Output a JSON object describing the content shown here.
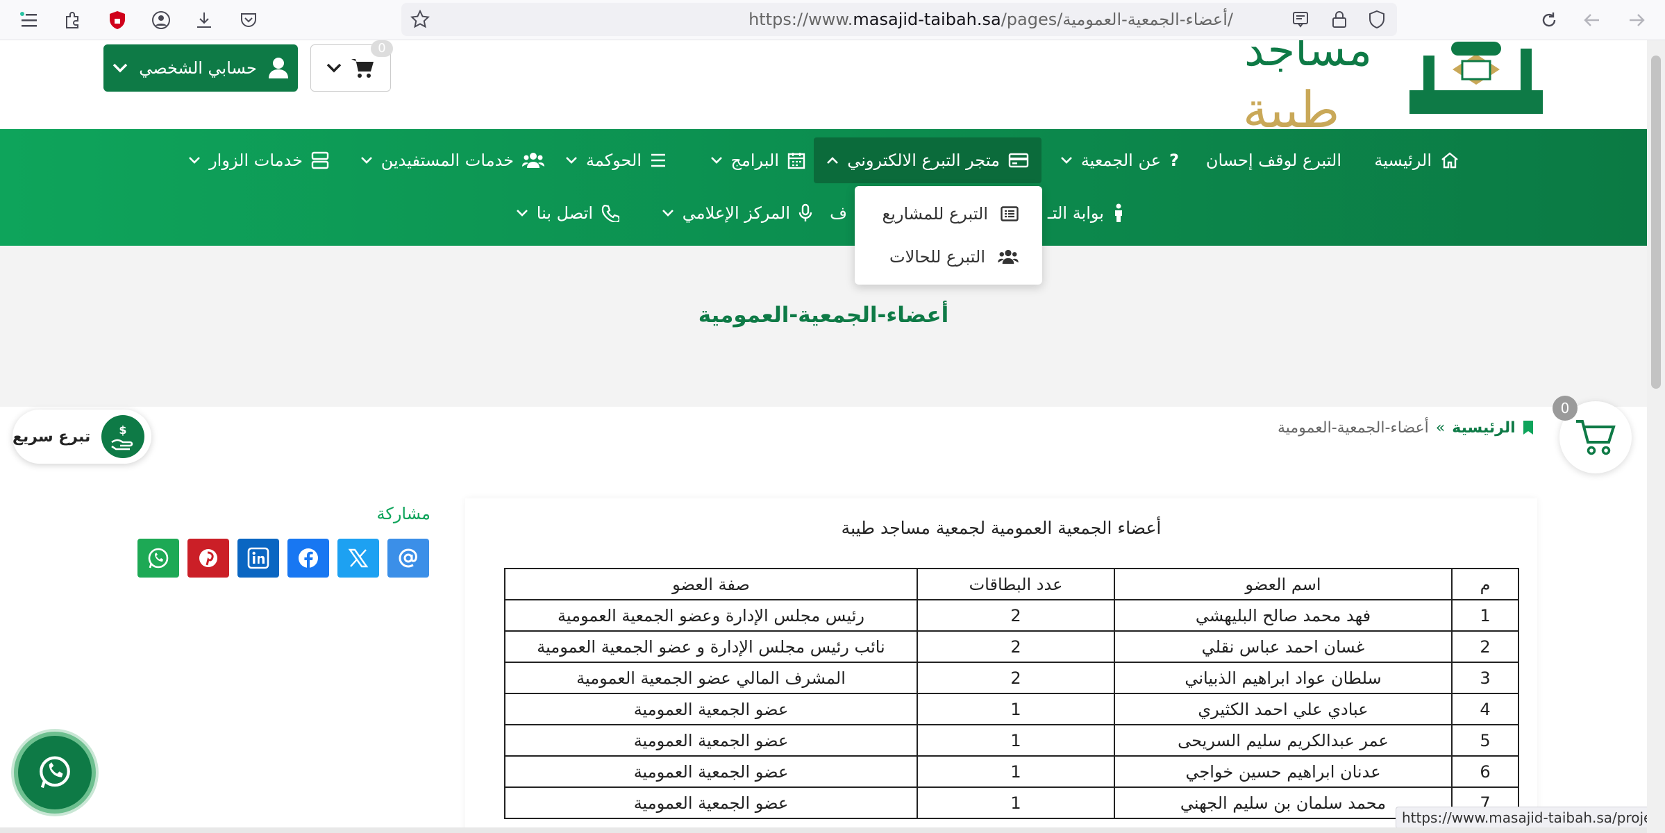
{
  "browser": {
    "url_prefix": "https://www.",
    "url_domain": "masajid-taibah.sa",
    "url_path": "/pages/أعضاء-الجمعية-العمومية/"
  },
  "header": {
    "logo_text_top": "مساجد",
    "logo_text": "طيبة",
    "account_label": "حسابي الشخصي",
    "cart_count": "0"
  },
  "nav": {
    "items": [
      {
        "label": "الرئيسية",
        "icon": "home-icon"
      },
      {
        "label": "التبرع لوقف إحسان",
        "icon": ""
      },
      {
        "label": "عن الجمعية",
        "icon": "question-icon"
      },
      {
        "label": "متجر التبرع الالكتروني",
        "icon": "card-icon"
      },
      {
        "label": "البرامج",
        "icon": "calendar-icon"
      },
      {
        "label": "الحوكمة",
        "icon": "list-icon"
      },
      {
        "label": "خدمات المستفيدين",
        "icon": "users-icon"
      },
      {
        "label": "خدمات الزوار",
        "icon": "server-icon"
      }
    ],
    "row2": [
      {
        "label": "بوابة التـ",
        "icon": "person-icon"
      },
      {
        "label": "ف",
        "icon": ""
      },
      {
        "label": "المركز الإعلامي",
        "icon": "mic-icon"
      },
      {
        "label": "اتصل بنا",
        "icon": "phone-icon"
      }
    ],
    "dropdown": [
      {
        "label": "التبرع للمشاريع",
        "icon": "list-alt-icon"
      },
      {
        "label": "التبرع للحالات",
        "icon": "users-icon"
      }
    ]
  },
  "hero": {
    "title": "أعضاء-الجمعية-العمومية"
  },
  "breadcrumb": {
    "home": "الرئيسية",
    "separator": "»",
    "current": "أعضاء-الجمعية-العمومية"
  },
  "floating": {
    "cart_count": "0",
    "quick_donate": "تبرع سريع"
  },
  "share": {
    "label": "مشاركة"
  },
  "content": {
    "title": "أعضاء الجمعية العمومية لجمعية مساجد طيبة",
    "columns": [
      "م",
      "اسم العضو",
      "عدد البطاقات",
      "صفة العضو"
    ],
    "rows": [
      [
        "1",
        "فهد محمد صالح البليهشي",
        "2",
        "رئيس مجلس الإدارة وعضو الجمعية العمومية"
      ],
      [
        "2",
        "غسان احمد عباس نقلي",
        "2",
        "نائب رئيس مجلس الإدارة و عضو الجمعية العمومية"
      ],
      [
        "3",
        "سلطان عواد ابراهيم الذبياني",
        "2",
        "المشرف المالي عضو الجمعية العمومية"
      ],
      [
        "4",
        "عبادي علي احمد الكثيري",
        "1",
        "عضو الجمعية العمومية"
      ],
      [
        "5",
        "عمر عبدالكريم سليم السريحى",
        "1",
        "عضو الجمعية العمومية"
      ],
      [
        "6",
        "عدنان ابراهيم حسين خواجي",
        "1",
        "عضو الجمعية العمومية"
      ],
      [
        "7",
        "محمد سلمان بن سليم الجهني",
        "1",
        "عضو الجمعية العمومية"
      ]
    ]
  },
  "status_url": "https://www.masajid-taibah.sa/projects/",
  "colors": {
    "brand_green": "#0e7a46",
    "nav_green": "#0ea45b",
    "gold": "#c9a858"
  }
}
